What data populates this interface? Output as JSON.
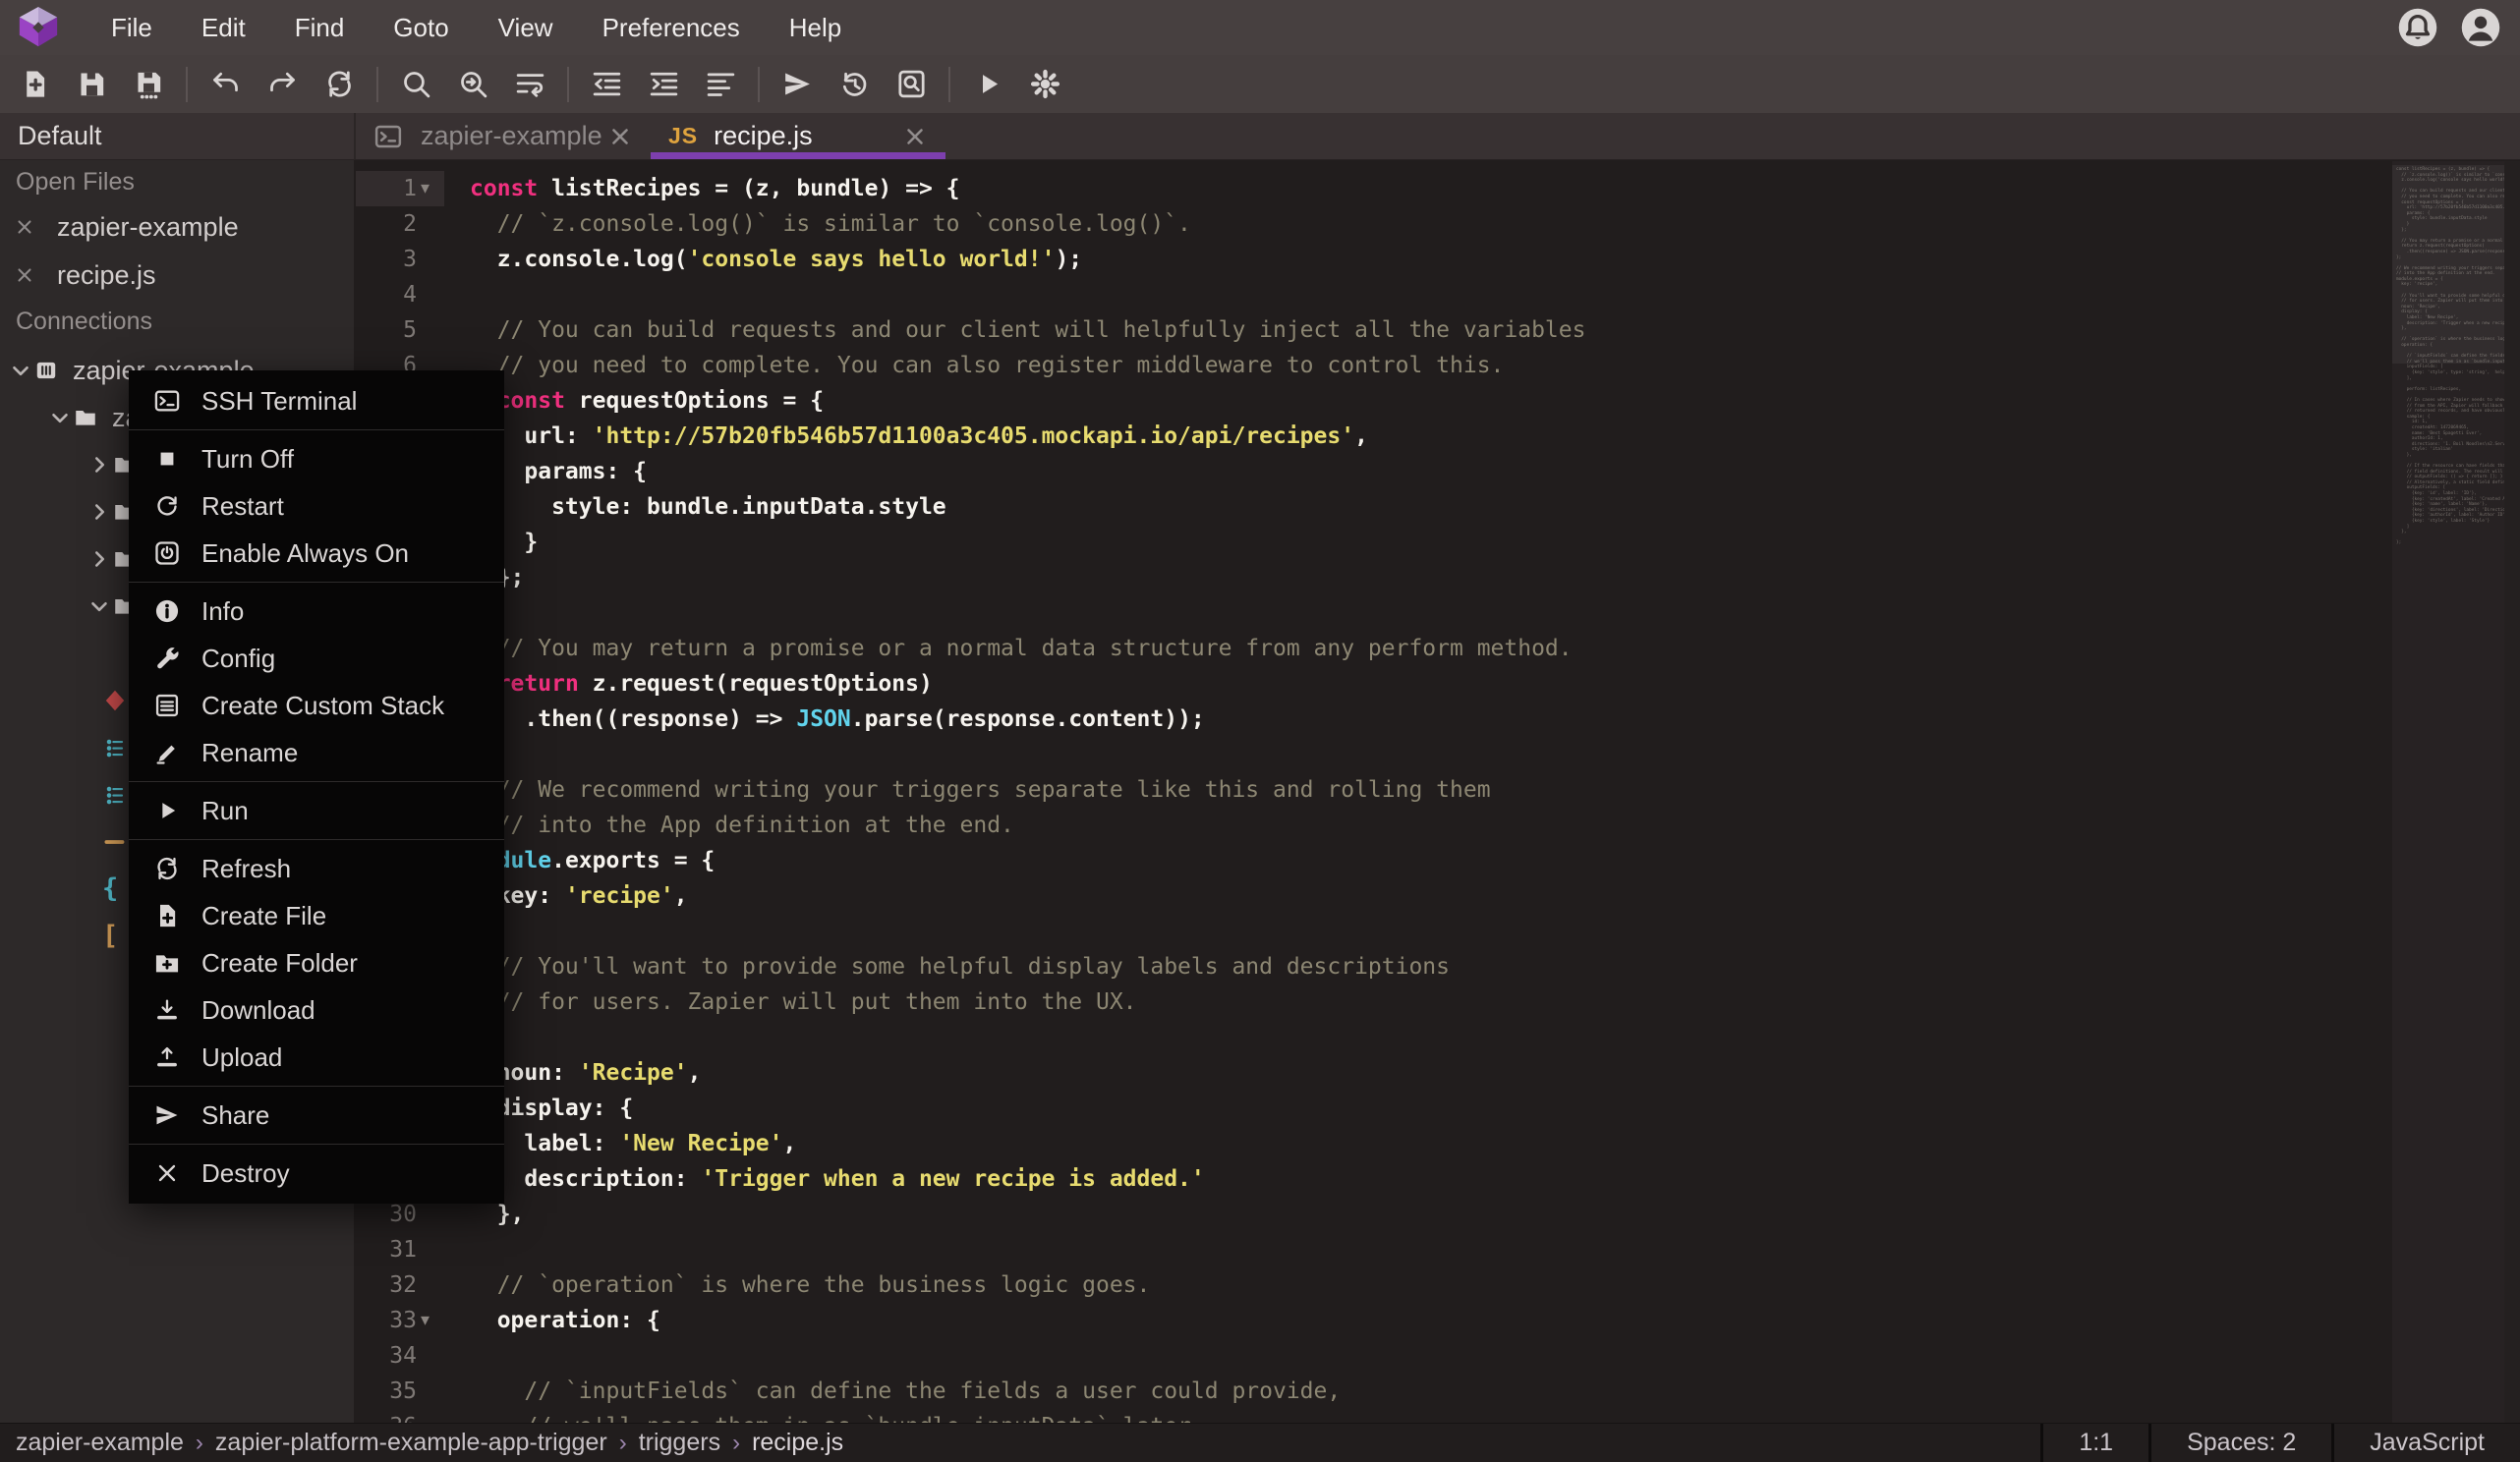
{
  "colors": {
    "accent": "#7d3fae",
    "keyword": "#f0307f",
    "string": "#e7db6f",
    "comment": "#8c8672",
    "plain": "#f6f3ee",
    "type": "#61d3ec",
    "js_badge": "#dfa33e"
  },
  "menubar": {
    "items": [
      "File",
      "Edit",
      "Find",
      "Goto",
      "View",
      "Preferences",
      "Help"
    ],
    "right_icons": [
      "notifications-icon",
      "account-icon"
    ]
  },
  "toolbar": {
    "groups": [
      [
        "new-file",
        "save",
        "save-all"
      ],
      [
        "undo",
        "redo",
        "sync"
      ],
      [
        "search",
        "find-next",
        "word-wrap"
      ],
      [
        "indent-decrease",
        "indent-increase",
        "format-align"
      ],
      [
        "deploy",
        "history",
        "search-in-files"
      ],
      [
        "run",
        "settings"
      ]
    ]
  },
  "sidebar": {
    "workspace_label": "Default",
    "open_files_label": "Open Files",
    "open_files": [
      "zapier-example",
      "recipe.js"
    ],
    "connections_label": "Connections",
    "tree": [
      {
        "indent": 0,
        "chevron": "down",
        "icon": "container-icon",
        "label": "zapier-example"
      },
      {
        "indent": 1,
        "chevron": "down",
        "icon": "folder-icon",
        "label": "zapier-platform-example-app-trigger"
      },
      {
        "indent": 2,
        "chevron": "right",
        "icon": "folder-icon",
        "label": ""
      },
      {
        "indent": 2,
        "chevron": "right",
        "icon": "folder-icon",
        "label": ""
      },
      {
        "indent": 2,
        "chevron": "right",
        "icon": "folder-icon",
        "label": ""
      },
      {
        "indent": 2,
        "chevron": "down",
        "icon": "folder-icon",
        "label": ""
      },
      {
        "indent": 3,
        "chevron": "",
        "icon": "",
        "label": ""
      },
      {
        "indent": 2,
        "chevron": "",
        "icon": "file-red-icon",
        "label": ""
      },
      {
        "indent": 2,
        "chevron": "",
        "icon": "file-teal-icon",
        "label": ""
      },
      {
        "indent": 2,
        "chevron": "",
        "icon": "file-teal-icon",
        "label": ""
      },
      {
        "indent": 2,
        "chevron": "",
        "icon": "file-orange-icon",
        "label": ""
      },
      {
        "indent": 2,
        "chevron": "",
        "icon": "file-brace-icon",
        "label": ""
      },
      {
        "indent": 2,
        "chevron": "",
        "icon": "file-bracket-icon",
        "label": ""
      }
    ]
  },
  "tabs": [
    {
      "label": "zapier-example",
      "icon": "terminal-icon",
      "active": false
    },
    {
      "label": "recipe.js",
      "icon": "js-icon",
      "active": true
    }
  ],
  "editor": {
    "lines": [
      {
        "fold": true,
        "cur": true,
        "t": [
          [
            "k",
            "const"
          ],
          [
            "p",
            " listRecipes = (z, bundle) => {"
          ]
        ]
      },
      {
        "t": [
          [
            "c",
            "  // `z.console.log()` is similar to `console.log()`."
          ]
        ]
      },
      {
        "t": [
          [
            "p",
            "  z.console.log("
          ],
          [
            "s",
            "'console says hello world!'"
          ],
          [
            "p",
            ");"
          ]
        ]
      },
      {
        "t": []
      },
      {
        "t": [
          [
            "c",
            "  // You can build requests and our client will helpfully inject all the variables"
          ]
        ]
      },
      {
        "t": [
          [
            "c",
            "  // you need to complete. You can also register middleware to control this."
          ]
        ]
      },
      {
        "t": [
          [
            "p",
            "  "
          ],
          [
            "k",
            "const"
          ],
          [
            "p",
            " requestOptions = {"
          ]
        ]
      },
      {
        "t": [
          [
            "p",
            "    url: "
          ],
          [
            "s",
            "'http://57b20fb546b57d1100a3c405.mockapi.io/api/recipes'"
          ],
          [
            "p",
            ","
          ]
        ]
      },
      {
        "t": [
          [
            "p",
            "    params: {"
          ]
        ]
      },
      {
        "t": [
          [
            "p",
            "      style: bundle.inputData.style"
          ]
        ]
      },
      {
        "t": [
          [
            "p",
            "    }"
          ]
        ]
      },
      {
        "t": [
          [
            "p",
            "  };"
          ]
        ]
      },
      {
        "t": []
      },
      {
        "t": [
          [
            "c",
            "  // You may return a promise or a normal data structure from any perform method."
          ]
        ]
      },
      {
        "t": [
          [
            "p",
            "  "
          ],
          [
            "k",
            "return"
          ],
          [
            "p",
            " z.request(requestOptions)"
          ]
        ]
      },
      {
        "t": [
          [
            "p",
            "    .then((response) => "
          ],
          [
            "t",
            "JSON"
          ],
          [
            "p",
            ".parse(response.content));"
          ]
        ]
      },
      {
        "t": []
      },
      {
        "t": [
          [
            "c",
            "  // We recommend writing your triggers separate like this and rolling them"
          ]
        ]
      },
      {
        "t": [
          [
            "c",
            "  // into the App definition at the end."
          ]
        ]
      },
      {
        "t": [
          [
            "t",
            "module"
          ],
          [
            "p",
            ".exports = {"
          ]
        ]
      },
      {
        "t": [
          [
            "p",
            "  key: "
          ],
          [
            "s",
            "'recipe'"
          ],
          [
            "p",
            ","
          ]
        ]
      },
      {
        "t": []
      },
      {
        "t": [
          [
            "c",
            "  // You'll want to provide some helpful display labels and descriptions"
          ]
        ]
      },
      {
        "t": [
          [
            "c",
            "  // for users. Zapier will put them into the UX."
          ]
        ]
      },
      {
        "t": []
      },
      {
        "t": [
          [
            "p",
            "  noun: "
          ],
          [
            "s",
            "'Recipe'"
          ],
          [
            "p",
            ","
          ]
        ]
      },
      {
        "t": [
          [
            "p",
            "  display: {"
          ]
        ]
      },
      {
        "t": [
          [
            "p",
            "    label: "
          ],
          [
            "s",
            "'New Recipe'"
          ],
          [
            "p",
            ","
          ]
        ]
      },
      {
        "t": [
          [
            "p",
            "    description: "
          ],
          [
            "s",
            "'Trigger when a new recipe is added.'"
          ]
        ]
      },
      {
        "t": [
          [
            "p",
            "  },"
          ]
        ]
      },
      {
        "t": []
      },
      {
        "t": [
          [
            "c",
            "  // `operation` is where the business logic goes."
          ]
        ]
      },
      {
        "fold": true,
        "t": [
          [
            "p",
            "  operation: {"
          ]
        ]
      },
      {
        "t": []
      },
      {
        "t": [
          [
            "c",
            "    // `inputFields` can define the fields a user could provide,"
          ]
        ]
      },
      {
        "t": [
          [
            "c",
            "    // we'll pass them in as `bundle.inputData` later."
          ]
        ]
      }
    ]
  },
  "minimap_text": "const listRecipes = (z, bundle) => {\n  // `z.console.log()` is similar to `consol\n  z.console.log('console says hello world!')\n\n  // You can build requests and our client w\n  // you need to complete. You can also regi\n  const requestOptions = {\n    url: 'http://57b20fb546b57d1100a3c405.mo\n    params: {\n      style: bundle.inputData.style\n    }\n  };\n\n  // You may return a promise or a normal da\n  return z.request(requestOptions)\n    .then((response) => JSON.parse(response.\n};\n\n// We recommend writing your triggers separa\n// into the App definition at the end.\nmodule.exports = {\n  key: 'recipe',\n\n  // You'll want to provide some helpful dis\n  // for users. Zapier will put them into th\n  noun: 'Recipe',\n  display: {\n    label: 'New Recipe',\n    description: 'Trigger when a new recipe\n  },\n\n  // `operation` is where the business logic\n  operation: {\n\n    // `inputFields` can define the fields\n    // we'll pass them in as `bundle.inputDa\n    inputFields: [\n      {key: 'style', type: 'string',  helpTe\n    ],\n\n    perform: listRecipes,\n\n    // In cases where Zapier needs to show a\n    // from the API, Zapier will fallback to\n    // returned records, and have obviously\n    sample: {\n      id: 1,\n      createdAt: 1472069465,\n      name: 'Best Spagetti Ever',\n      authorId: 1,\n      directions: '1. Boil Noodles\\n2.Serve\n      style: 'italian'\n    },\n\n    // If the resource can have fields that\n    // field definitions. The result will be\n    // outputFields: () => { return []; }\n    // Alternatively, a static field definit\n    outputFields: [\n      {key: 'id', label: 'ID'},\n      {key: 'createdAt', label: 'Created At'\n      {key: 'name', label: 'Name'},\n      {key: 'directions', label: 'Directions\n      {key: 'authorId', label: 'Author ID'},\n      {key: 'style', label: 'Style'}\n    ]\n  },\n\n};",
  "context_menu": {
    "groups": [
      [
        {
          "icon": "terminal-icon",
          "label": "SSH Terminal"
        }
      ],
      [
        {
          "icon": "stop-icon",
          "label": "Turn Off"
        },
        {
          "icon": "restart-icon",
          "label": "Restart"
        },
        {
          "icon": "power-icon",
          "label": "Enable Always On"
        }
      ],
      [
        {
          "icon": "info-icon",
          "label": "Info"
        },
        {
          "icon": "wrench-icon",
          "label": "Config"
        },
        {
          "icon": "stack-icon",
          "label": "Create Custom Stack"
        },
        {
          "icon": "pencil-icon",
          "label": "Rename"
        }
      ],
      [
        {
          "icon": "play-icon",
          "label": "Run"
        }
      ],
      [
        {
          "icon": "sync-icon",
          "label": "Refresh"
        },
        {
          "icon": "file-plus-icon",
          "label": "Create File"
        },
        {
          "icon": "folder-plus-icon",
          "label": "Create Folder"
        },
        {
          "icon": "download-icon",
          "label": "Download"
        },
        {
          "icon": "upload-icon",
          "label": "Upload"
        }
      ],
      [
        {
          "icon": "send-icon",
          "label": "Share"
        }
      ],
      [
        {
          "icon": "close-icon",
          "label": "Destroy"
        }
      ]
    ]
  },
  "status_bar": {
    "breadcrumb": [
      "zapier-example",
      "zapier-platform-example-app-trigger",
      "triggers",
      "recipe.js"
    ],
    "separator": "›",
    "cursor": "1:1",
    "indentation": "Spaces: 2",
    "language": "JavaScript"
  }
}
